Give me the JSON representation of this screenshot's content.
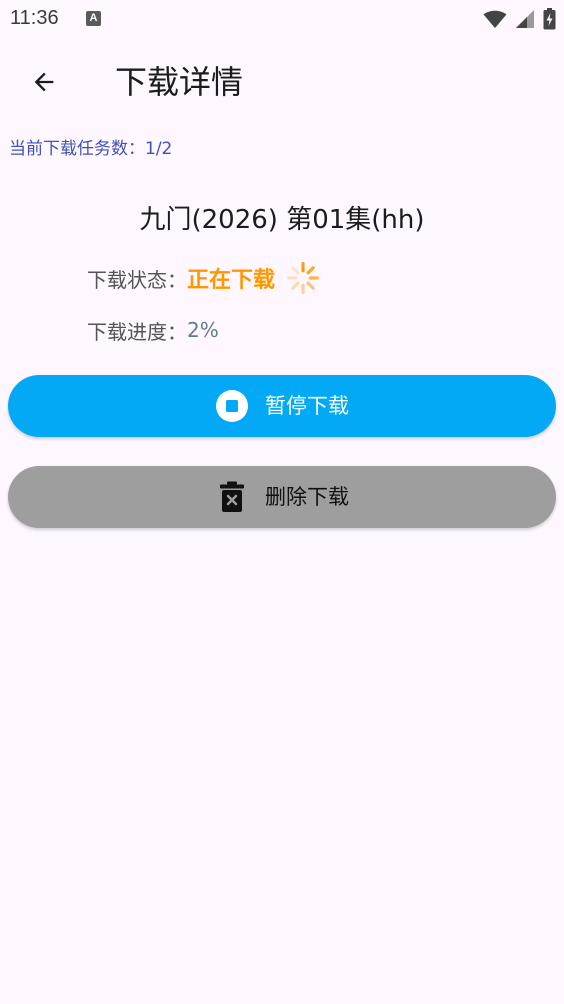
{
  "status_bar": {
    "time": "11:36",
    "notification_icon": "A"
  },
  "app_bar": {
    "title": "下载详情"
  },
  "summary": {
    "task_count_text": "当前下载任务数：1/2"
  },
  "download": {
    "title": "九门(2026) 第01集(hh)",
    "status_label": "下载状态：",
    "status_value": "正在下载",
    "progress_label": "下载进度：",
    "progress_value": "2%"
  },
  "actions": {
    "pause_label": "暂停下载",
    "delete_label": "删除下载"
  },
  "colors": {
    "background": "#FEF7FF",
    "accent_text": "#3F51B5",
    "status_orange": "#FF9800",
    "pause_button": "#03A9F4",
    "delete_button": "#9E9E9E"
  },
  "icons": {
    "back": "arrow-back-icon",
    "wifi": "wifi-icon",
    "signal": "cell-signal-icon",
    "battery": "battery-charging-icon",
    "spinner": "loading-spinner-icon",
    "pause": "stop-circle-icon",
    "delete": "trash-icon"
  }
}
